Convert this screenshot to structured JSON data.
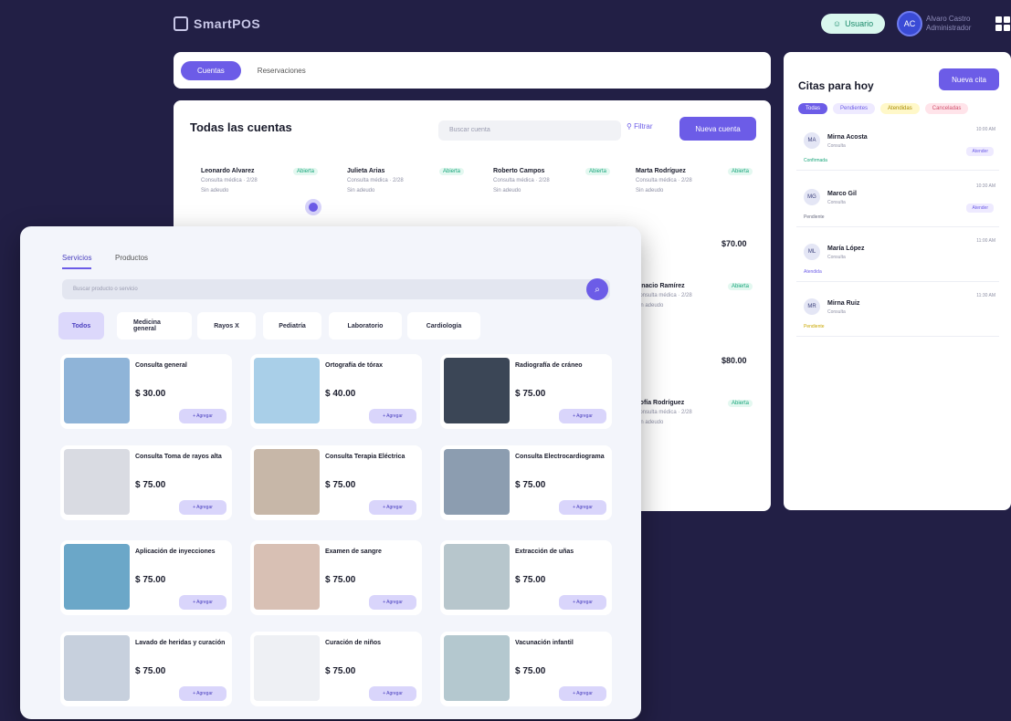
{
  "app": {
    "name": "SmartPOS"
  },
  "header": {
    "user_button": "Usuario",
    "avatar_initials": "AC",
    "user_name_line1": "Alvaro Castro",
    "user_name_line2": "Administrador"
  },
  "tabs": [
    {
      "label": "Cuentas"
    },
    {
      "label": "Reservaciones"
    }
  ],
  "accounts": {
    "title": "Todas las cuentas",
    "search_placeholder": "Buscar cuenta",
    "filter_label": "Filtrar",
    "new_button": "Nueva cuenta",
    "cards": [
      {
        "name": "Leonardo Alvarez",
        "status": "Abierta",
        "line1": "Consulta médica · 2/28",
        "line2": "Sin adeudo",
        "amount": ""
      },
      {
        "name": "Julieta Arias",
        "status": "Abierta",
        "line1": "Consulta médica · 2/28",
        "line2": "Sin adeudo",
        "amount": ""
      },
      {
        "name": "Roberto Campos",
        "status": "Abierta",
        "line1": "Consulta médica · 2/28",
        "line2": "Sin adeudo",
        "amount": ""
      },
      {
        "name": "Marta Rodríguez",
        "status": "Abierta",
        "line1": "Consulta médica · 2/28",
        "line2": "Sin adeudo",
        "amount": "$70.00"
      },
      {
        "name": "Ignacio Ramírez",
        "status": "Abierta",
        "line1": "Consulta médica · 2/28",
        "line2": "Sin adeudo",
        "amount": "$80.00"
      },
      {
        "name": "Sofía Rodríguez",
        "status": "Abierta",
        "line1": "Consulta médica · 2/28",
        "line2": "Sin adeudo",
        "amount": ""
      }
    ]
  },
  "citas": {
    "title": "Citas para hoy",
    "add_button": "Nueva cita",
    "filters": [
      "Todas",
      "Pendientes",
      "Atendidas",
      "Canceladas"
    ],
    "items": [
      {
        "initials": "MA",
        "name": "Mirna Acosta",
        "sub": "Consulta",
        "time": "10:00 AM",
        "status": "Confirmada",
        "action": "Atender"
      },
      {
        "initials": "MG",
        "name": "Marco Gil",
        "sub": "Consulta",
        "time": "10:30 AM",
        "status": "Pendiente",
        "action": "Atender"
      },
      {
        "initials": "ML",
        "name": "María López",
        "sub": "Consulta",
        "time": "11:00 AM",
        "status": "Atendida",
        "action": ""
      },
      {
        "initials": "MR",
        "name": "Mirna Ruiz",
        "sub": "Consulta",
        "time": "11:30 AM",
        "status": "Pendiente",
        "action": ""
      }
    ]
  },
  "products": {
    "tabs": [
      "Servicios",
      "Productos"
    ],
    "search_placeholder": "Buscar producto o servicio",
    "categories": [
      "Todos",
      "Medicina general",
      "Rayos X",
      "Pediatría",
      "Laboratorio",
      "Cardiología"
    ],
    "add_label": "+ Agregar",
    "items": [
      {
        "name": "Consulta general",
        "price": "$ 30.00",
        "color": "#8fb4d8"
      },
      {
        "name": "Ortografía de tórax",
        "price": "$ 40.00",
        "color": "#a9cfe8"
      },
      {
        "name": "Radiografía de cráneo",
        "price": "$ 75.00",
        "color": "#3b4656"
      },
      {
        "name": "Consulta Toma de rayos alta",
        "price": "$ 75.00",
        "color": "#d9dbe2"
      },
      {
        "name": "Consulta Terapia Eléctrica",
        "price": "$ 75.00",
        "color": "#c7b7a8"
      },
      {
        "name": "Consulta Electrocardiograma",
        "price": "$ 75.00",
        "color": "#8c9db0"
      },
      {
        "name": "Aplicación de inyecciones",
        "price": "$ 75.00",
        "color": "#6ba7c8"
      },
      {
        "name": "Examen de sangre",
        "price": "$ 75.00",
        "color": "#d8c0b4"
      },
      {
        "name": "Extracción de uñas",
        "price": "$ 75.00",
        "color": "#b7c6cc"
      },
      {
        "name": "Lavado de heridas y curación",
        "price": "$ 75.00",
        "color": "#c7d0dd"
      },
      {
        "name": "Curación de niños",
        "price": "$ 75.00",
        "color": "#eef0f4"
      },
      {
        "name": "Vacunación infantil",
        "price": "$ 75.00",
        "color": "#b4c8cf"
      }
    ]
  }
}
